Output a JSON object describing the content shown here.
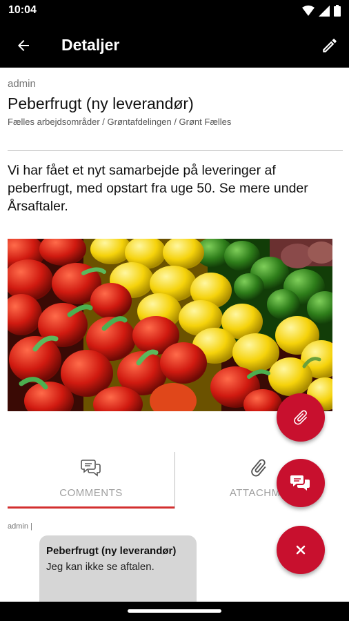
{
  "status_bar": {
    "time": "10:04"
  },
  "app_bar": {
    "title": "Detaljer"
  },
  "post": {
    "author": "admin",
    "title": "Peberfrugt (ny leverandør)",
    "path": "Fælles arbejdsområder / Grøntafdelingen / Grønt Fælles",
    "body": "Vi har fået et nyt samarbejde på leveringer af peberfrugt, med opstart fra uge 50. Se mere under Årsaftaler."
  },
  "tabs": {
    "comments_label": "COMMENTS",
    "attachments_label": "ATTACHME"
  },
  "comment": {
    "meta": "admin |",
    "title": "Peberfrugt (ny leverandør)",
    "text": "Jeg kan ikke se aftalen."
  },
  "colors": {
    "accent": "#c8102e",
    "tab_indicator": "#d32f2f",
    "app_bar": "#000000",
    "bubble": "#d6d6d6"
  },
  "icons": [
    "back-arrow-icon",
    "pencil-icon",
    "paperclip-icon",
    "comments-icon",
    "close-icon",
    "wifi-icon",
    "signal-icon",
    "battery-icon"
  ]
}
